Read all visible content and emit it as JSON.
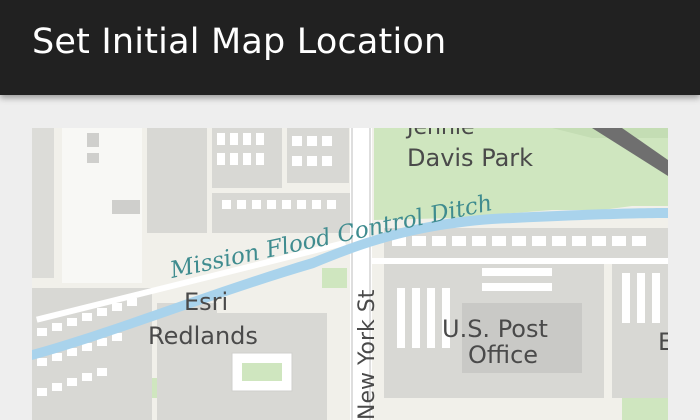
{
  "app": {
    "title": "Set Initial Map Location"
  },
  "map": {
    "labels": {
      "park": "Davis Park",
      "park_top": "Jennie",
      "ditch": "Mission Flood Control Ditch",
      "street": "New York St",
      "esri_line1": "Esri",
      "esri_line2": "Redlands",
      "post_line1": "U.S. Post",
      "post_line2": "Office",
      "edge_letter": "E"
    },
    "colors": {
      "park": "#cfe6bf",
      "water": "#a9d3ec",
      "building": "#d9d9d6",
      "building_dark": "#c9c9c6",
      "street": "#ffffff",
      "header": "#212121"
    }
  }
}
